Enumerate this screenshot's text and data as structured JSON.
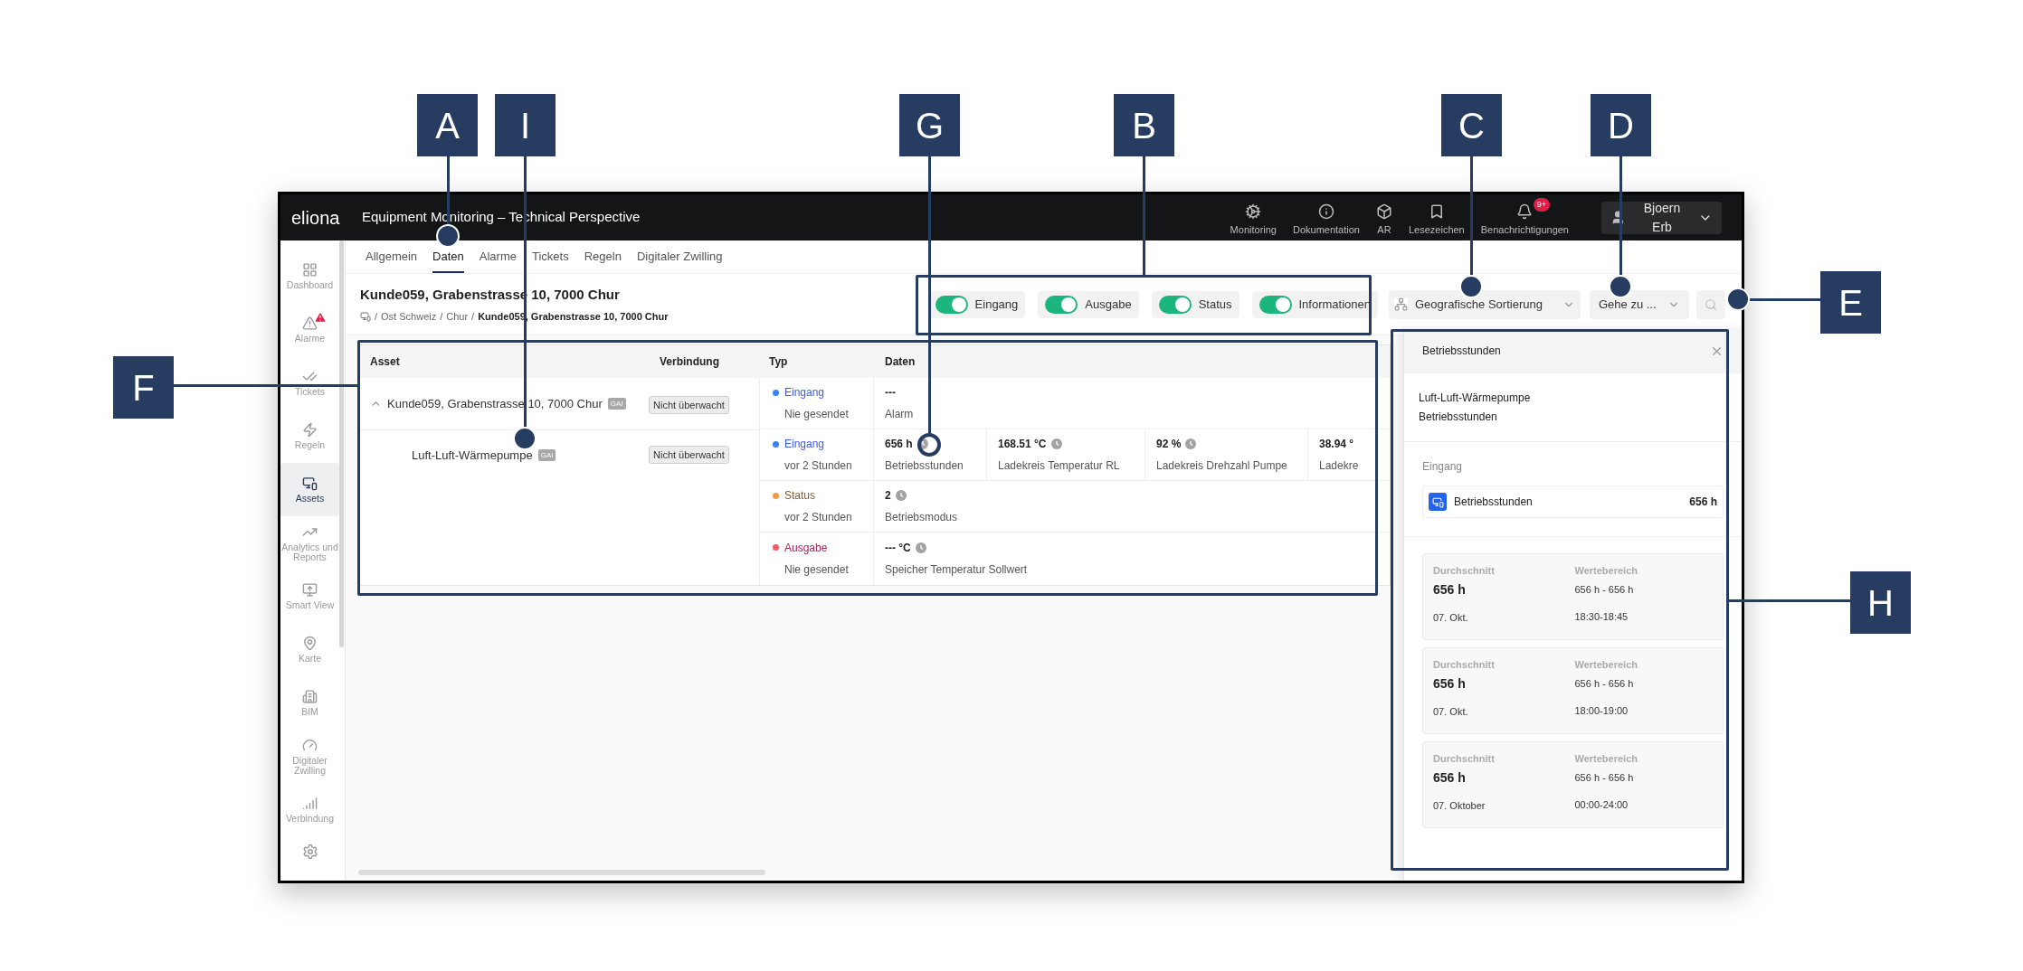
{
  "callouts": [
    {
      "label": "A"
    },
    {
      "label": "I"
    },
    {
      "label": "G"
    },
    {
      "label": "B"
    },
    {
      "label": "C"
    },
    {
      "label": "D"
    },
    {
      "label": "E"
    },
    {
      "label": "F"
    },
    {
      "label": "H"
    }
  ],
  "topbar": {
    "logo": "eliona",
    "title": "Equipment Monitoring – Technical Perspective",
    "actions": [
      {
        "label": "Monitoring"
      },
      {
        "label": "Dokumentation"
      },
      {
        "label": "AR"
      },
      {
        "label": "Lesezeichen"
      },
      {
        "label": "Benachrichtigungen",
        "badge": "9+"
      }
    ],
    "user": "Bjoern Erb"
  },
  "sidebar": {
    "items": [
      {
        "label": "Dashboard",
        "selected": false,
        "alert": false
      },
      {
        "label": "Alarme",
        "selected": false,
        "alert": true
      },
      {
        "label": "Tickets",
        "selected": false,
        "alert": false
      },
      {
        "label": "Regeln",
        "selected": false,
        "alert": false
      },
      {
        "label": "Assets",
        "selected": true,
        "alert": false
      },
      {
        "label": "Analytics und Reports",
        "selected": false,
        "alert": false
      },
      {
        "label": "Smart View",
        "selected": false,
        "alert": false
      },
      {
        "label": "Karte",
        "selected": false,
        "alert": false
      },
      {
        "label": "BIM",
        "selected": false,
        "alert": false
      },
      {
        "label": "Digitaler Zwilling",
        "selected": false,
        "alert": false
      },
      {
        "label": "Verbindung",
        "selected": false,
        "alert": false
      }
    ]
  },
  "tabs": [
    {
      "label": "Allgemein",
      "selected": false
    },
    {
      "label": "Daten",
      "selected": true
    },
    {
      "label": "Alarme",
      "selected": false
    },
    {
      "label": "Tickets",
      "selected": false
    },
    {
      "label": "Regeln",
      "selected": false
    },
    {
      "label": "Digitaler Zwilling",
      "selected": false
    }
  ],
  "header": {
    "title": "Kunde059, Grabenstrasse 10, 7000 Chur",
    "breadcrumb": [
      {
        "sep": "/",
        "label": "Ost Schweiz"
      },
      {
        "sep": "/",
        "label": "Chur"
      },
      {
        "sep": "/",
        "label": "Kunde059, Grabenstrasse 10, 7000 Chur"
      }
    ]
  },
  "filters": [
    {
      "label": "Eingang",
      "on": true
    },
    {
      "label": "Ausgabe",
      "on": true
    },
    {
      "label": "Status",
      "on": true
    },
    {
      "label": "Informationen",
      "on": true
    }
  ],
  "sort_dropdown": "Geografische Sortierung",
  "goto_dropdown": "Gehe zu ...",
  "table": {
    "columns": [
      "Asset",
      "Verbindung",
      "Typ",
      "Daten"
    ],
    "assets": [
      {
        "name": "Kunde059, Grabenstrasse 10, 7000 Chur",
        "tag": "GAI",
        "connection": "Nicht überwacht",
        "expanded": true,
        "children": [
          {
            "name": "Luft-Luft-Wärmepumpe",
            "tag": "GAI",
            "connection": "Nicht überwacht"
          }
        ]
      }
    ],
    "data_rows": [
      {
        "kind": "input",
        "type": "Eingang",
        "color": "#3b82f6",
        "time": "Nie gesendet",
        "values": [
          {
            "value": "---",
            "name": "Alarm",
            "history": false
          }
        ]
      },
      {
        "kind": "input",
        "type": "Eingang",
        "color": "#3b82f6",
        "time": "vor 2 Stunden",
        "values": [
          {
            "value": "656 h",
            "name": "Betriebsstunden",
            "history": true
          },
          {
            "value": "168.51 °C",
            "name": "Ladekreis Temperatur RL",
            "history": true
          },
          {
            "value": "92 %",
            "name": "Ladekreis Drehzahl Pumpe",
            "history": true
          },
          {
            "value": "38.94 °",
            "name": "Ladekre",
            "history": false
          }
        ]
      },
      {
        "kind": "status",
        "type": "Status",
        "color": "#f09a4a",
        "time": "vor 2 Stunden",
        "values": [
          {
            "value": "2",
            "name": "Betriebsmodus",
            "history": true
          }
        ]
      },
      {
        "kind": "output",
        "type": "Ausgabe",
        "color": "#f05a64",
        "time": "Nie gesendet",
        "values": [
          {
            "value": "--- °C",
            "name": "Speicher Temperatur Sollwert",
            "history": true
          }
        ]
      }
    ]
  },
  "panel": {
    "title": "Betriebsstunden",
    "subtitle": [
      "Luft-Luft-Wärmepumpe",
      "Betriebsstunden"
    ],
    "section": "Eingang",
    "item": {
      "name": "Betriebsstunden",
      "value": "656 h"
    },
    "stats": [
      {
        "avg_label": "Durchschnitt",
        "avg": "656 h",
        "date": "07. Okt.",
        "range_label": "Wertebereich",
        "range": "656 h - 656 h",
        "time": "18:30-18:45"
      },
      {
        "avg_label": "Durchschnitt",
        "avg": "656 h",
        "date": "07. Okt.",
        "range_label": "Wertebereich",
        "range": "656 h - 656 h",
        "time": "18:00-19:00"
      },
      {
        "avg_label": "Durchschnitt",
        "avg": "656 h",
        "date": "07. Oktober",
        "range_label": "Wertebereich",
        "range": "656 h - 656 h",
        "time": "00:00-24:00"
      }
    ]
  }
}
